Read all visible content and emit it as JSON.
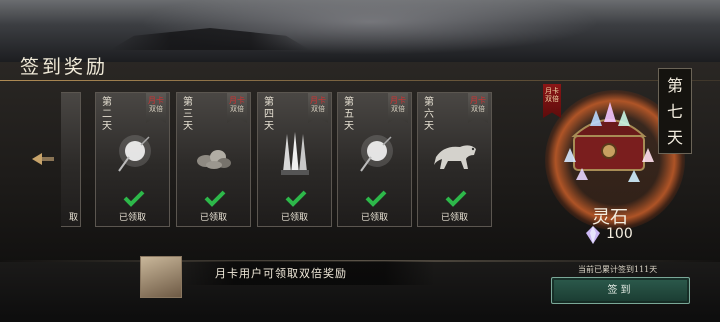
{
  "header": {
    "title": "签到奖励"
  },
  "cards": [
    {
      "day": "",
      "item": "token-icon",
      "status": "取"
    },
    {
      "day": "第二天",
      "item": "orb-pendant-icon",
      "status": "已领取"
    },
    {
      "day": "第三天",
      "item": "ore-pile-icon",
      "status": "已领取"
    },
    {
      "day": "第四天",
      "item": "claws-icon",
      "status": "已领取"
    },
    {
      "day": "第五天",
      "item": "orb-pendant-icon",
      "status": "已领取"
    },
    {
      "day": "第六天",
      "item": "tiger-icon",
      "status": "已领取"
    }
  ],
  "double_tag": {
    "top": "月卡",
    "bottom": "双倍"
  },
  "day7": {
    "label": "第七天",
    "reward_name": "灵石",
    "reward_count": "100",
    "double_tag": {
      "top": "月卡",
      "bottom": "双倍"
    }
  },
  "footer": {
    "monthly_card_text": "月卡用户可领取双倍奖励",
    "total_signin_text": "当前已累计签到111天",
    "sign_button_label": "签到"
  },
  "colors": {
    "accent_green": "#2c5a4c",
    "check_green": "#2db84a",
    "glow_orange": "#be5a28",
    "double_red": "#8b1616"
  }
}
